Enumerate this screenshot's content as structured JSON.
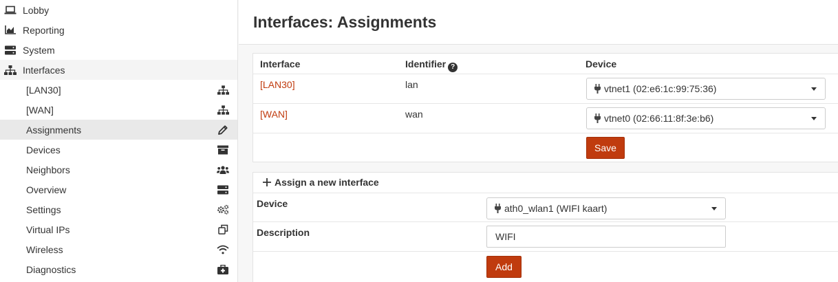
{
  "sidebar": {
    "top_items": [
      {
        "label": "Lobby",
        "icon": "laptop-icon"
      },
      {
        "label": "Reporting",
        "icon": "area-chart-icon"
      },
      {
        "label": "System",
        "icon": "server-icon"
      },
      {
        "label": "Interfaces",
        "icon": "sitemap-icon"
      }
    ],
    "sub_items": [
      {
        "label": "[LAN30]",
        "icon": "sitemap-icon"
      },
      {
        "label": "[WAN]",
        "icon": "sitemap-icon"
      },
      {
        "label": "Assignments",
        "icon": "pencil-icon"
      },
      {
        "label": "Devices",
        "icon": "archive-icon"
      },
      {
        "label": "Neighbors",
        "icon": "users-icon"
      },
      {
        "label": "Overview",
        "icon": "server-icon"
      },
      {
        "label": "Settings",
        "icon": "cogs-icon"
      },
      {
        "label": "Virtual IPs",
        "icon": "clone-icon"
      },
      {
        "label": "Wireless",
        "icon": "wifi-icon"
      },
      {
        "label": "Diagnostics",
        "icon": "medkit-icon"
      }
    ]
  },
  "page": {
    "title": "Interfaces: Assignments"
  },
  "assignments": {
    "headers": {
      "interface": "Interface",
      "identifier": "Identifier",
      "device": "Device"
    },
    "rows": [
      {
        "interface": "[LAN30]",
        "identifier": "lan",
        "device": "vtnet1 (02:e6:1c:99:75:36)"
      },
      {
        "interface": "[WAN]",
        "identifier": "wan",
        "device": "vtnet0 (02:66:11:8f:3e:b6)"
      }
    ],
    "save_label": "Save"
  },
  "new_interface": {
    "title": "Assign a new interface",
    "device_label": "Device",
    "device_value": "ath0_wlan1 (WIFI kaart)",
    "description_label": "Description",
    "description_value": "WIFI",
    "add_label": "Add"
  },
  "colors": {
    "accent": "#c03b0e"
  }
}
